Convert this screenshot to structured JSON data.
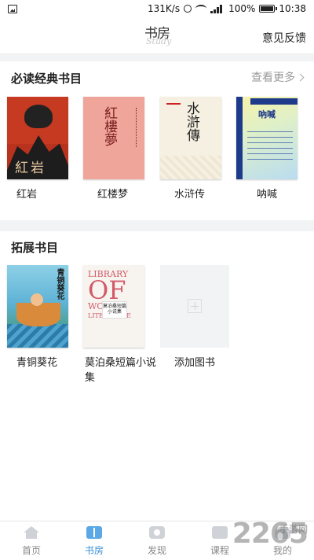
{
  "status_bar": {
    "speed": "131K/s",
    "battery": "100%",
    "time": "10:38"
  },
  "header": {
    "logo_cn": "书房",
    "logo_en": "Study",
    "feedback": "意见反馈"
  },
  "required": {
    "title": "必读经典书目",
    "more": "查看更多",
    "books": [
      {
        "title": "红岩",
        "cover_text": "紅岩"
      },
      {
        "title": "红楼梦",
        "cover_text": "紅樓夢"
      },
      {
        "title": "水浒传",
        "cover_text": "水滸傳"
      },
      {
        "title": "呐喊",
        "cover_text": "吶喊"
      }
    ]
  },
  "extended": {
    "title": "拓展书目",
    "books": [
      {
        "title": "青铜葵花",
        "cover_text": "青铜葵花"
      },
      {
        "title": "莫泊桑短篇小说集",
        "cover_text_1": "LIBRARY",
        "cover_text_2": "OF",
        "cover_text_3": "WORLD",
        "cover_text_4": "LITERATURE",
        "cover_tag": "莫泊桑短篇小说集"
      }
    ],
    "add_label": "添加图书"
  },
  "tabbar": {
    "items": [
      {
        "label": "首页",
        "icon": "home-icon"
      },
      {
        "label": "书房",
        "icon": "bookshelf-icon"
      },
      {
        "label": "发现",
        "icon": "discover-icon"
      },
      {
        "label": "课程",
        "icon": "course-icon"
      },
      {
        "label": "我的",
        "icon": "profile-icon"
      }
    ],
    "active": "书房"
  },
  "watermark": {
    "main": "2265",
    "sub": "手游网"
  },
  "colors": {
    "accent": "#3a8fd6",
    "section_gap": "#f2f3f5"
  }
}
